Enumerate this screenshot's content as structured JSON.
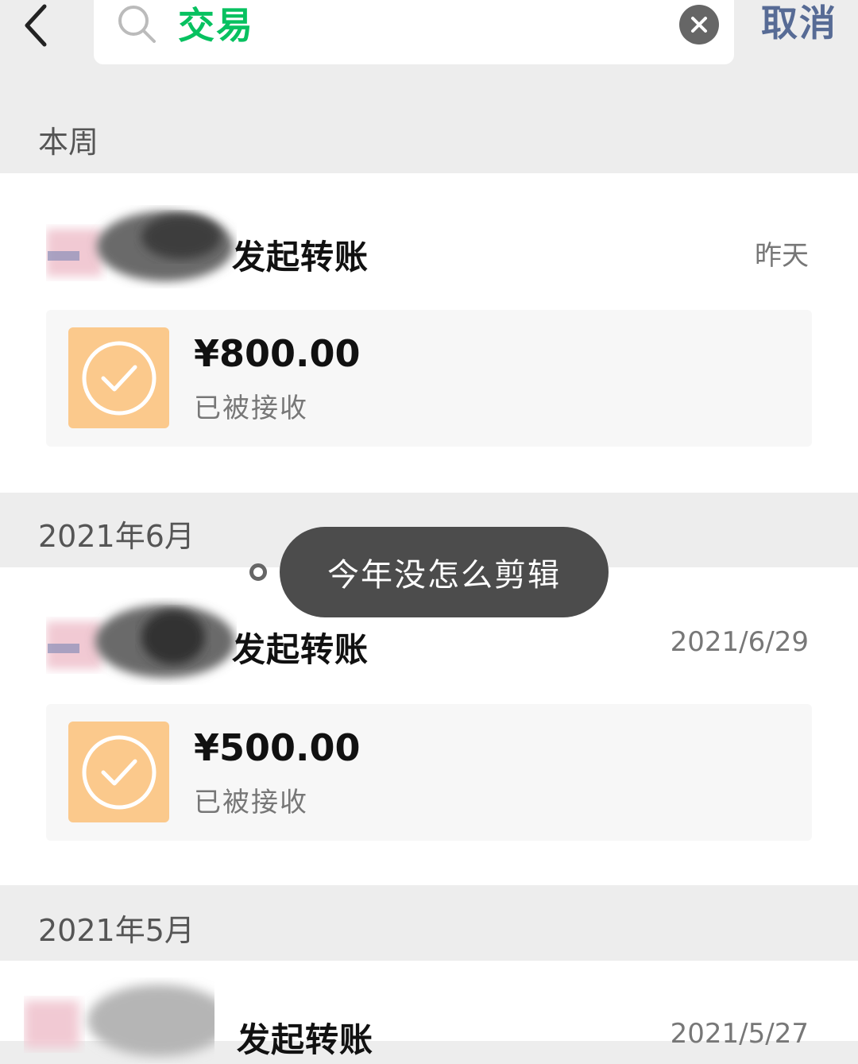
{
  "search": {
    "query": "交易",
    "cancel_label": "取消"
  },
  "sections": [
    {
      "header": "本周",
      "transaction": {
        "title": "发起转账",
        "date": "昨天",
        "amount": "¥800.00",
        "status": "已被接收"
      }
    },
    {
      "header": "2021年6月",
      "transaction": {
        "title": "发起转账",
        "date": "2021/6/29",
        "amount": "¥500.00",
        "status": "已被接收"
      }
    },
    {
      "header": "2021年5月",
      "transaction": {
        "title": "发起转账",
        "date": "2021/5/27"
      }
    }
  ],
  "toast": {
    "text": "今年没怎么剪辑"
  },
  "colors": {
    "accent_green": "#07c160",
    "link_blue": "#576b95",
    "badge_orange": "#fbc98c",
    "toast_bg": "#4c4c4c"
  },
  "icons": [
    "back-chevron-icon",
    "search-icon",
    "clear-icon",
    "check-circle-icon"
  ]
}
